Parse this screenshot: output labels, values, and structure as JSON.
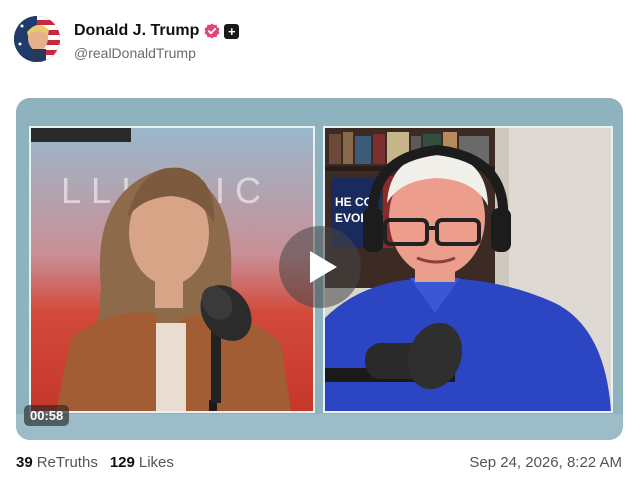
{
  "post": {
    "author_name": "Donald J. Trump",
    "handle": "@realDonaldTrump",
    "verified_icon": "verified-badge-icon",
    "plus_icon": "plus-badge-icon",
    "plus_glyph": "+"
  },
  "media": {
    "duration": "00:58",
    "play_icon": "play-icon",
    "left_backdrop_text": "LLIAMIC",
    "right_book_text_1": "HE CO",
    "right_book_text_2": "EVOLUTIO"
  },
  "stats": {
    "retruths_count": "39",
    "retruths_label": "ReTruths",
    "likes_count": "129",
    "likes_label": "Likes"
  },
  "timestamp": "Sep 24, 2026, 8:22 AM",
  "colors": {
    "verified_badge": "#e0457b",
    "media_frame": "#8fb2bf",
    "text_muted": "#555555"
  }
}
